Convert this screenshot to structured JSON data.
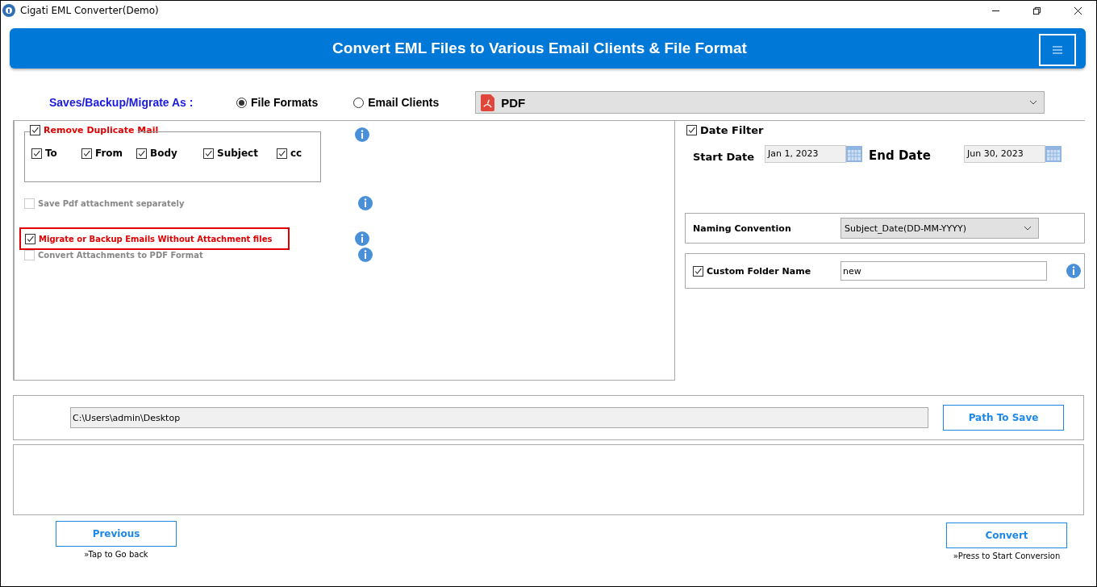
{
  "window": {
    "title": "Cigati EML Converter(Demo)"
  },
  "header": {
    "title": "Convert EML Files to Various Email Clients & File Format"
  },
  "save_as": {
    "label": "Saves/Backup/Migrate As :",
    "options": [
      {
        "label": "File Formats",
        "selected": true
      },
      {
        "label": "Email Clients",
        "selected": false
      }
    ],
    "format": "PDF"
  },
  "duplicate": {
    "label": "Remove Duplicate Mail",
    "checked": true,
    "fields": [
      {
        "label": "To",
        "checked": true
      },
      {
        "label": "From",
        "checked": true
      },
      {
        "label": "Body",
        "checked": true
      },
      {
        "label": "Subject",
        "checked": true
      },
      {
        "label": "cc",
        "checked": true
      }
    ]
  },
  "options": [
    {
      "label": "Save Pdf attachment separately",
      "checked": false,
      "disabled": true,
      "highlighted": false
    },
    {
      "label": "Migrate or Backup Emails Without Attachment files",
      "checked": true,
      "disabled": false,
      "highlighted": true
    },
    {
      "label": "Convert Attachments to PDF Format",
      "checked": false,
      "disabled": true,
      "highlighted": false
    }
  ],
  "date_filter": {
    "label": "Date Filter",
    "checked": true,
    "start_label": "Start Date",
    "start_value": "Jan 1, 2023",
    "end_label": "End Date",
    "end_value": "Jun 30, 2023"
  },
  "naming": {
    "label": "Naming Convention",
    "value": "Subject_Date(DD-MM-YYYY)"
  },
  "custom_folder": {
    "label": "Custom Folder Name",
    "checked": true,
    "value": "new"
  },
  "path": {
    "value": "C:\\Users\\admin\\Desktop",
    "button": "Path To Save"
  },
  "previous": {
    "label": "Previous",
    "hint": "»Tap to Go back"
  },
  "convert": {
    "label": "Convert",
    "hint": "»Press to Start Conversion"
  }
}
